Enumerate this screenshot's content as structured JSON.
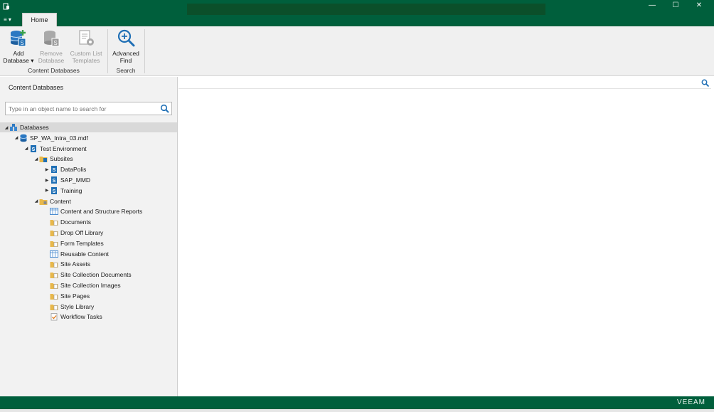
{
  "titlebar": {
    "tab_home": "Home",
    "menu_glyph": "≡ ▾",
    "controls": {
      "minimize": "—",
      "maximize": "☐",
      "close": "✕"
    }
  },
  "ribbon": {
    "groups": [
      {
        "label": "Content Databases",
        "buttons": [
          {
            "line1": "Add",
            "line2": "Database ▾",
            "icon": "add-database-icon",
            "enabled": true
          },
          {
            "line1": "Remove",
            "line2": "Database",
            "icon": "remove-database-icon",
            "enabled": false
          },
          {
            "line1": "Custom List",
            "line2": "Templates",
            "icon": "custom-list-templates-icon",
            "enabled": false
          }
        ]
      },
      {
        "label": "Search",
        "buttons": [
          {
            "line1": "Advanced",
            "line2": "Find",
            "icon": "advanced-find-icon",
            "enabled": true
          }
        ]
      }
    ]
  },
  "left_pane": {
    "title": "Content Databases",
    "search_placeholder": "Type in an object name to search for",
    "tree": [
      {
        "label": "Databases",
        "level": 0,
        "arrow": "◢",
        "icon": "databases-icon"
      },
      {
        "label": "SP_WA_Intra_03.mdf",
        "level": 1,
        "arrow": "◢",
        "icon": "database-icon"
      },
      {
        "label": "Test Environment",
        "level": 2,
        "arrow": "◢",
        "icon": "sharepoint-site-icon"
      },
      {
        "label": "Subsites",
        "level": 3,
        "arrow": "◢",
        "icon": "subsites-folder-icon"
      },
      {
        "label": "DataPolis",
        "level": 4,
        "arrow": "▶",
        "icon": "sharepoint-site-icon"
      },
      {
        "label": "SAP_MMD",
        "level": 4,
        "arrow": "▶",
        "icon": "sharepoint-site-icon"
      },
      {
        "label": "Training",
        "level": 4,
        "arrow": "▶",
        "icon": "sharepoint-site-icon"
      },
      {
        "label": "Content",
        "level": 3,
        "arrow": "◢",
        "icon": "content-folder-icon"
      },
      {
        "label": "Content and Structure Reports",
        "level": 4,
        "arrow": "",
        "icon": "list-icon"
      },
      {
        "label": "Documents",
        "level": 4,
        "arrow": "",
        "icon": "library-icon"
      },
      {
        "label": "Drop Off Library",
        "level": 4,
        "arrow": "",
        "icon": "library-icon"
      },
      {
        "label": "Form Templates",
        "level": 4,
        "arrow": "",
        "icon": "library-icon"
      },
      {
        "label": "Reusable Content",
        "level": 4,
        "arrow": "",
        "icon": "list-icon"
      },
      {
        "label": "Site Assets",
        "level": 4,
        "arrow": "",
        "icon": "library-icon"
      },
      {
        "label": "Site Collection Documents",
        "level": 4,
        "arrow": "",
        "icon": "library-icon"
      },
      {
        "label": "Site Collection Images",
        "level": 4,
        "arrow": "",
        "icon": "library-icon"
      },
      {
        "label": "Site Pages",
        "level": 4,
        "arrow": "",
        "icon": "library-icon"
      },
      {
        "label": "Style Library",
        "level": 4,
        "arrow": "",
        "icon": "library-icon"
      },
      {
        "label": "Workflow Tasks",
        "level": 4,
        "arrow": "",
        "icon": "tasks-icon"
      }
    ]
  },
  "statusbar": {
    "brand": "VEEAM"
  },
  "colors": {
    "brand_green": "#005f3c",
    "ribbon_bg": "#f0f0f0",
    "pane_bg": "#f2f2f2",
    "selection_bg": "#d9d9d9",
    "icon_blue": "#1f6fb5",
    "folder_yellow": "#e8b84a"
  }
}
